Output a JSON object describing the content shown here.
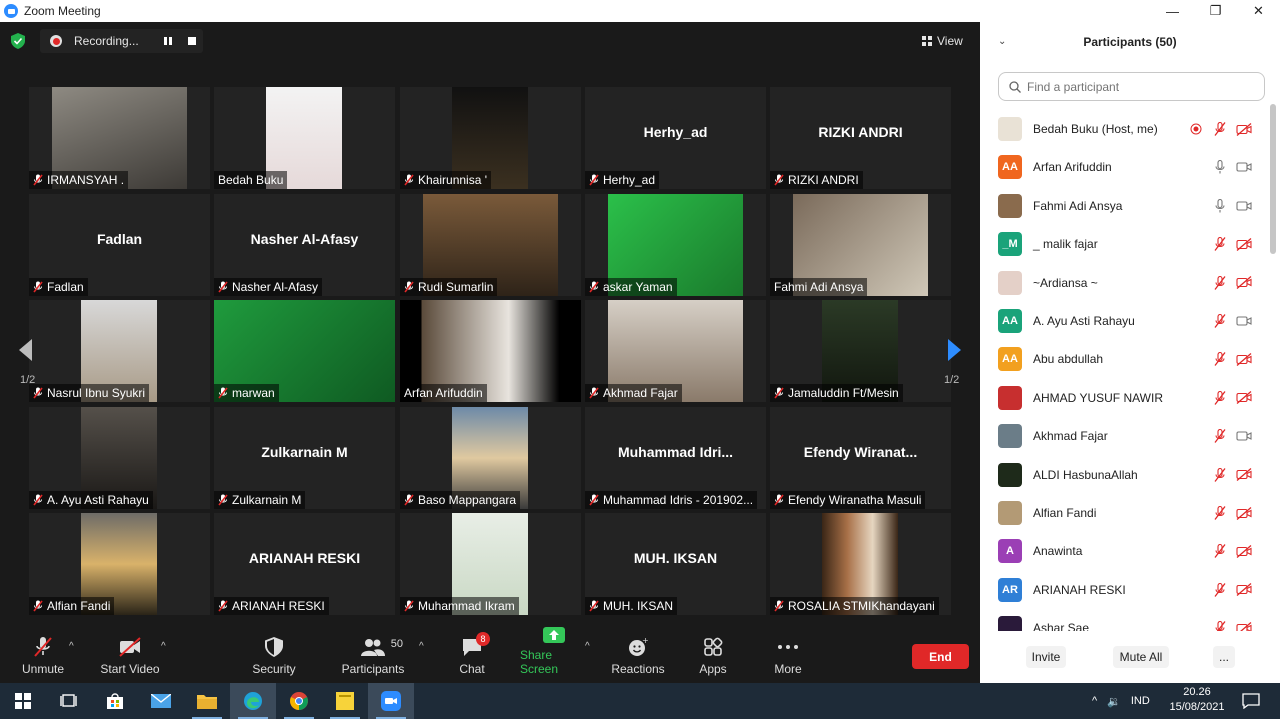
{
  "window": {
    "title": "Zoom Meeting"
  },
  "meeting": {
    "recording_label": "Recording...",
    "view_label": "View",
    "page_indicator_left": "1/2",
    "page_indicator_right": "1/2",
    "tiles": [
      {
        "display": "",
        "label": "IRMANSYAH .",
        "video": true,
        "muted": true
      },
      {
        "display": "",
        "label": "Bedah Buku",
        "video": true,
        "muted": false
      },
      {
        "display": "",
        "label": "Khairunnisa '",
        "video": true,
        "muted": true
      },
      {
        "display": "Herhy_ad",
        "label": "Herhy_ad",
        "video": false,
        "muted": true
      },
      {
        "display": "RIZKI ANDRI",
        "label": "RIZKI ANDRI",
        "video": false,
        "muted": true
      },
      {
        "display": "Fadlan",
        "label": "Fadlan",
        "video": false,
        "muted": true
      },
      {
        "display": "Nasher Al-Afasy",
        "label": "Nasher Al-Afasy",
        "video": false,
        "muted": true
      },
      {
        "display": "",
        "label": "Rudi Sumarlin",
        "video": true,
        "muted": true
      },
      {
        "display": "",
        "label": "askar Yaman",
        "video": true,
        "muted": true
      },
      {
        "display": "",
        "label": "Fahmi Adi Ansya",
        "video": true,
        "muted": false
      },
      {
        "display": "",
        "label": "Nasrul Ibnu Syukri",
        "video": true,
        "muted": true
      },
      {
        "display": "",
        "label": "marwan",
        "video": true,
        "muted": true
      },
      {
        "display": "",
        "label": "Arfan Arifuddin",
        "video": true,
        "muted": false
      },
      {
        "display": "",
        "label": "Akhmad Fajar",
        "video": true,
        "muted": true
      },
      {
        "display": "",
        "label": "Jamaluddin Ft/Mesin",
        "video": true,
        "muted": true
      },
      {
        "display": "",
        "label": "A. Ayu Asti Rahayu",
        "video": true,
        "muted": true
      },
      {
        "display": "Zulkarnain M",
        "label": "Zulkarnain M",
        "video": false,
        "muted": true
      },
      {
        "display": "",
        "label": "Baso Mappangara",
        "video": true,
        "muted": true
      },
      {
        "display": "Muhammad  Idri...",
        "label": "Muhammad Idris - 201902...",
        "video": false,
        "muted": true
      },
      {
        "display": "Efendy  Wiranat...",
        "label": "Efendy Wiranatha Masuli",
        "video": false,
        "muted": true
      },
      {
        "display": "",
        "label": "Alfian Fandi",
        "video": true,
        "muted": true
      },
      {
        "display": "ARIANAH RESKI",
        "label": "ARIANAH RESKI",
        "video": false,
        "muted": true
      },
      {
        "display": "",
        "label": "Muhammad Ikram",
        "video": true,
        "muted": true
      },
      {
        "display": "MUH. IKSAN",
        "label": "MUH. IKSAN",
        "video": false,
        "muted": true
      },
      {
        "display": "",
        "label": "ROSALIA STMIKhandayani",
        "video": true,
        "muted": true
      }
    ]
  },
  "toolbar": {
    "unmute": "Unmute",
    "start_video": "Start Video",
    "security": "Security",
    "participants": "Participants",
    "participants_count": "50",
    "chat": "Chat",
    "chat_badge": "8",
    "share_screen": "Share Screen",
    "reactions": "Reactions",
    "apps": "Apps",
    "more": "More",
    "end": "End"
  },
  "panel": {
    "title": "Participants (50)",
    "search_placeholder": "Find a participant",
    "participants": [
      {
        "name": "Bedah Buku (Host, me)",
        "initials": "",
        "avatar_color": "#e9e2d6",
        "mic": "muted",
        "video": "off",
        "recording": true
      },
      {
        "name": "Arfan Arifuddin",
        "initials": "AA",
        "avatar_color": "#f0661f",
        "mic": "on",
        "video": "on"
      },
      {
        "name": "Fahmi Adi Ansya",
        "initials": "",
        "avatar_color": "#8a6b4d",
        "mic": "on",
        "video": "on"
      },
      {
        "name": "_ malik fajar",
        "initials": "_M",
        "avatar_color": "#1aa37a",
        "mic": "muted",
        "video": "off"
      },
      {
        "name": "~Ardiansa ~",
        "initials": "",
        "avatar_color": "#e4d0c8",
        "mic": "muted",
        "video": "off"
      },
      {
        "name": "A. Ayu Asti Rahayu",
        "initials": "AA",
        "avatar_color": "#1aa37a",
        "mic": "muted",
        "video": "on"
      },
      {
        "name": "Abu abdullah",
        "initials": "AA",
        "avatar_color": "#f2a01f",
        "mic": "muted",
        "video": "off"
      },
      {
        "name": "AHMAD YUSUF NAWIR",
        "initials": "",
        "avatar_color": "#c72f2f",
        "mic": "muted",
        "video": "off"
      },
      {
        "name": "Akhmad Fajar",
        "initials": "",
        "avatar_color": "#6b7d88",
        "mic": "muted",
        "video": "on"
      },
      {
        "name": "ALDI HasbunaAllah",
        "initials": "",
        "avatar_color": "#1e2a1a",
        "mic": "muted",
        "video": "off"
      },
      {
        "name": "Alfian Fandi",
        "initials": "",
        "avatar_color": "#b39a75",
        "mic": "muted",
        "video": "off"
      },
      {
        "name": "Anawinta",
        "initials": "A",
        "avatar_color": "#9b3fb5",
        "mic": "muted",
        "video": "off"
      },
      {
        "name": "ARIANAH RESKI",
        "initials": "AR",
        "avatar_color": "#2f7fd6",
        "mic": "muted",
        "video": "off"
      },
      {
        "name": "Ashar Sae",
        "initials": "",
        "avatar_color": "#2a1a3a",
        "mic": "muted",
        "video": "off"
      }
    ],
    "invite": "Invite",
    "mute_all": "Mute All",
    "more": "..."
  },
  "taskbar": {
    "language": "IND",
    "time": "20.26",
    "date": "15/08/2021"
  }
}
